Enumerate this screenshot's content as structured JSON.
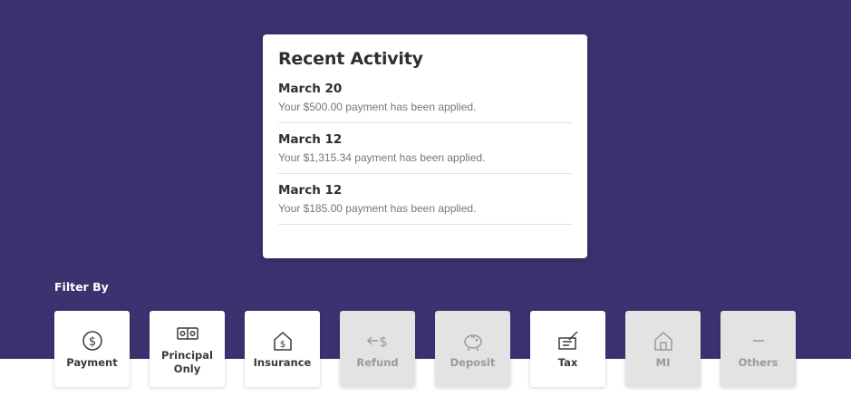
{
  "activity": {
    "title": "Recent Activity",
    "items": [
      {
        "date": "March 20",
        "description": "Your $500.00 payment has been applied."
      },
      {
        "date": "March 12",
        "description": "Your $1,315.34 payment has been applied."
      },
      {
        "date": "March 12",
        "description": "Your $185.00 payment has been applied."
      }
    ]
  },
  "filter": {
    "label": "Filter By",
    "options": [
      {
        "label": "Payment",
        "icon": "dollar-circle-icon",
        "enabled": true
      },
      {
        "label": "Principal Only",
        "icon": "cash-icon",
        "enabled": true
      },
      {
        "label": "Insurance",
        "icon": "house-dollar-icon",
        "enabled": true
      },
      {
        "label": "Refund",
        "icon": "refund-arrow-icon",
        "enabled": false
      },
      {
        "label": "Deposit",
        "icon": "piggy-bank-icon",
        "enabled": false
      },
      {
        "label": "Tax",
        "icon": "tax-icon",
        "enabled": true
      },
      {
        "label": "MI",
        "icon": "home-icon",
        "enabled": false
      },
      {
        "label": "Others",
        "icon": "dash-icon",
        "enabled": false
      }
    ]
  },
  "colors": {
    "hero_background": "#3d3270",
    "card_background": "#ffffff",
    "disabled_filter": "#e3e3e3"
  }
}
